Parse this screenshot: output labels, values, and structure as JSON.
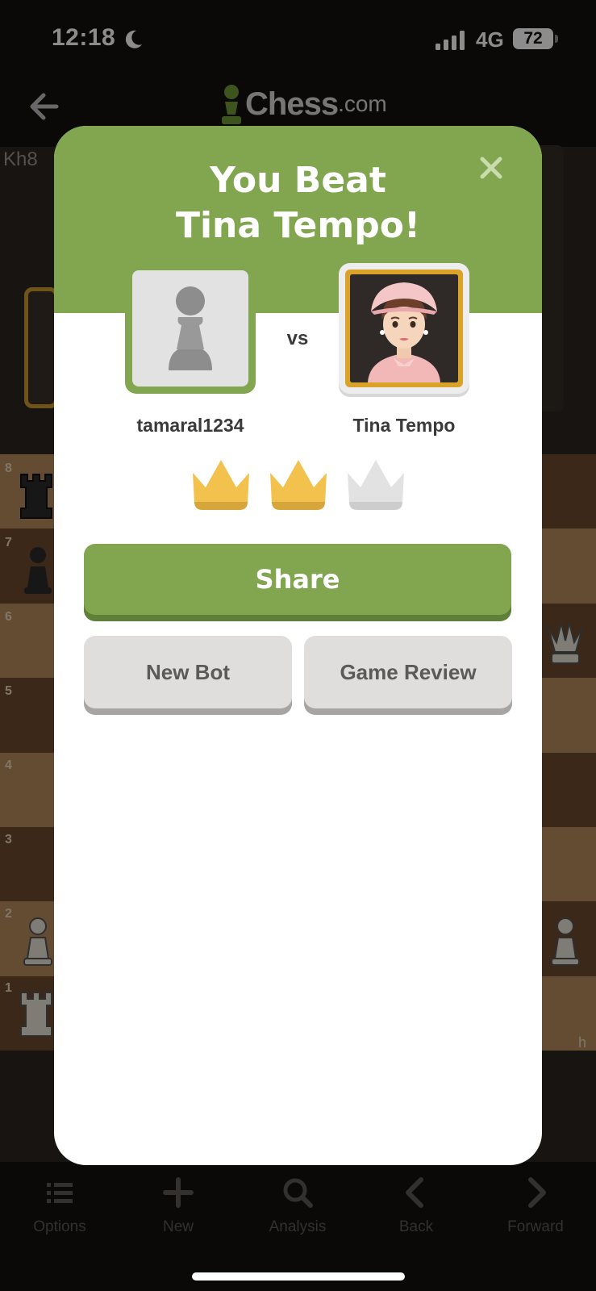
{
  "status_bar": {
    "time": "12:18",
    "network": "4G",
    "battery": "72"
  },
  "header": {
    "logo_main": "Chess",
    "logo_suffix": ".com"
  },
  "background": {
    "move_text": "Kh8",
    "ranks": [
      "8",
      "7",
      "6",
      "5",
      "4",
      "3",
      "2",
      "1"
    ],
    "file_letter": "h"
  },
  "modal": {
    "title_line1": "You Beat",
    "title_line2": "Tina Tempo!",
    "vs": "vs",
    "player": {
      "name": "tamaral1234"
    },
    "opponent": {
      "name": "Tina Tempo"
    },
    "crowns": {
      "earned": 2,
      "total": 3,
      "earned_color": "#f2c14e",
      "empty_color": "#e2e2e2"
    },
    "share_label": "Share",
    "new_bot_label": "New Bot",
    "game_review_label": "Game Review"
  },
  "bottom_nav": {
    "items": [
      {
        "label": "Options",
        "icon": "list-icon"
      },
      {
        "label": "New",
        "icon": "plus-icon"
      },
      {
        "label": "Analysis",
        "icon": "magnifier-icon"
      },
      {
        "label": "Back",
        "icon": "chevron-left-icon"
      },
      {
        "label": "Forward",
        "icon": "chevron-right-icon"
      }
    ]
  },
  "colors": {
    "brand_green": "#81a64f",
    "brand_green_dark": "#5f8038",
    "gold": "#d9a32a"
  }
}
